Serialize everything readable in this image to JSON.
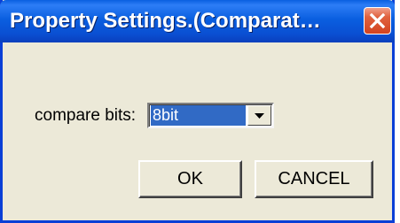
{
  "window": {
    "title": "Property Settings.(Comparat…"
  },
  "form": {
    "compare_bits_label": "compare bits:",
    "compare_bits_value": "8bit"
  },
  "buttons": {
    "ok_label": "OK",
    "cancel_label": "CANCEL"
  },
  "icons": {
    "close": "close-icon",
    "dropdown": "chevron-down-icon"
  },
  "colors": {
    "titlebar": "#0a5fe0",
    "close_button": "#d3431f",
    "selection": "#316ac5",
    "window_face": "#ece9d8"
  }
}
